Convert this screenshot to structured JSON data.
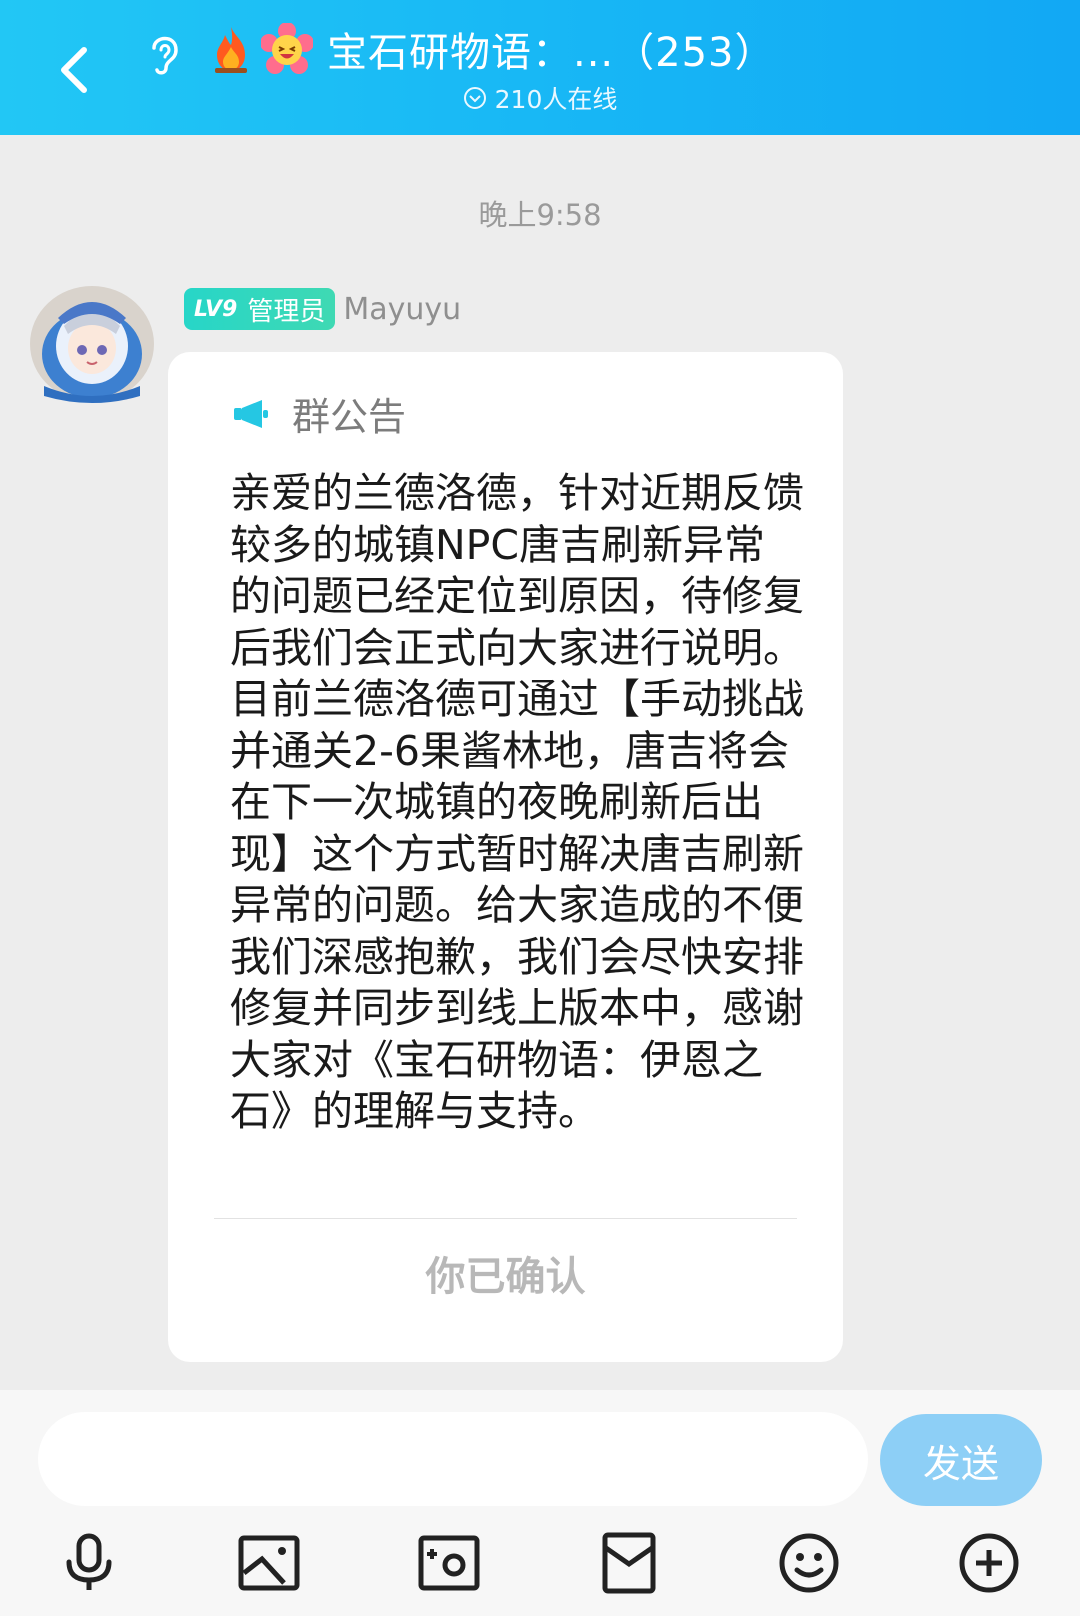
{
  "header": {
    "title": "宝石研物语：...（253）",
    "online_count": "210人在线",
    "bg_color": "#17b6f5"
  },
  "chat": {
    "timestamp": "晚上9:58",
    "message": {
      "badge_level": "LV9",
      "badge_role": "管理员",
      "sender": "Mayuyu",
      "notice_title": "群公告",
      "notice_body": "亲爱的兰德洛德，针对近期反馈较多的城镇NPC唐吉刷新异常的问题已经定位到原因，待修复后我们会正式向大家进行说明。目前兰德洛德可通过【手动挑战并通关2-6果酱林地，唐吉将会在下一次城镇的夜晚刷新后出现】这个方式暂时解决唐吉刷新异常的问题。给大家造成的不便我们深感抱歉，我们会尽快安排修复并同步到线上版本中，感谢大家对《宝石研物语：伊恩之石》的理解与支持。",
      "confirm_label": "你已确认"
    }
  },
  "input_bar": {
    "placeholder": "",
    "send_label": "发送",
    "tools": [
      "microphone-icon",
      "image-icon",
      "camera-icon",
      "red-packet-icon",
      "emoji-icon",
      "plus-icon"
    ]
  }
}
